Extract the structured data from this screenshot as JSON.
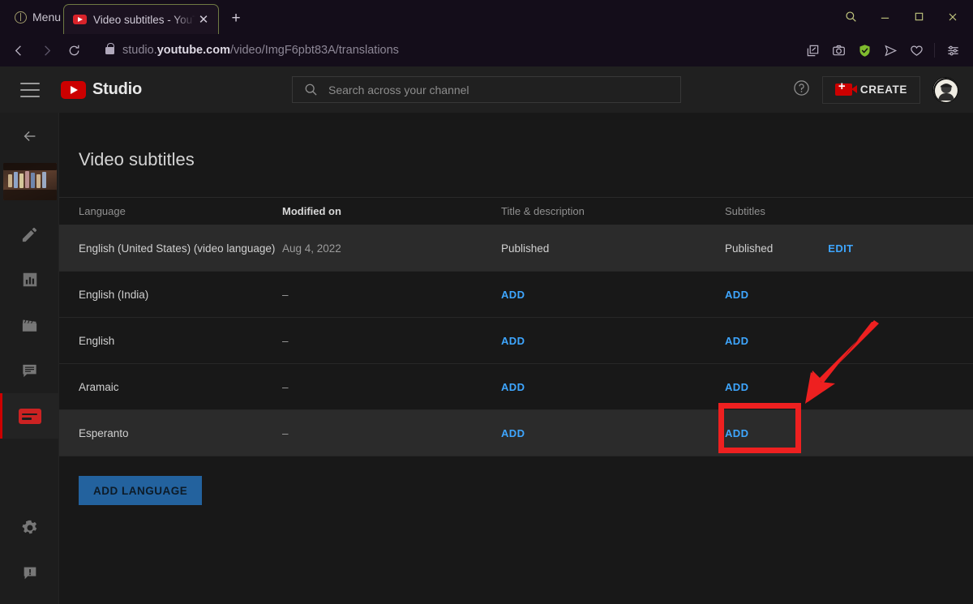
{
  "browser": {
    "menu_label": "Menu",
    "tab": {
      "title": "Video subtitles - YouTube S",
      "favicon": "youtube-favicon",
      "close": "✕"
    },
    "new_tab": "+",
    "url": {
      "domain_pre": "studio.",
      "domain_bold": "youtube.com",
      "path": "/video/ImgF6pbt83A/translations"
    },
    "window_controls": [
      "search-icon",
      "minimize-icon",
      "maximize-icon",
      "close-icon"
    ],
    "toolbar_icons": [
      "collections-icon",
      "screenshot-icon",
      "shield-verified-icon",
      "send-icon",
      "favorite-heart-icon",
      "settings-sliders-icon"
    ],
    "colors": {
      "shield_ok": "#7fbb2e",
      "window_control": "#c2c77f",
      "tab_border": "#6f7a43"
    }
  },
  "studio": {
    "brand": "Studio",
    "search": {
      "placeholder": "Search across your channel"
    },
    "create_label": "CREATE",
    "sidebar": {
      "items": [
        {
          "name": "back-arrow",
          "label": "Back"
        },
        {
          "name": "video-thumbnail",
          "label": "Video thumbnail"
        },
        {
          "name": "details-pencil",
          "label": "Details"
        },
        {
          "name": "analytics",
          "label": "Analytics"
        },
        {
          "name": "editor",
          "label": "Editor"
        },
        {
          "name": "comments",
          "label": "Comments"
        },
        {
          "name": "subtitles",
          "label": "Subtitles",
          "active": true
        },
        {
          "name": "settings",
          "label": "Settings"
        },
        {
          "name": "feedback",
          "label": "Send feedback"
        }
      ]
    }
  },
  "page": {
    "title": "Video subtitles",
    "columns": [
      "Language",
      "Modified on",
      "Title & description",
      "Subtitles"
    ],
    "rows": [
      {
        "language": "English (United States) (video language)",
        "modified": "Aug 4, 2022",
        "title_desc": "Published",
        "subtitles_status": "Published",
        "action": "EDIT",
        "shaded": true
      },
      {
        "language": "English (India)",
        "modified": "–",
        "title_desc": "ADD",
        "subtitles_status": "",
        "action": "ADD",
        "shaded": false
      },
      {
        "language": "English",
        "modified": "–",
        "title_desc": "ADD",
        "subtitles_status": "",
        "action": "ADD",
        "shaded": false
      },
      {
        "language": "Aramaic",
        "modified": "–",
        "title_desc": "ADD",
        "subtitles_status": "",
        "action": "ADD",
        "shaded": false
      },
      {
        "language": "Esperanto",
        "modified": "–",
        "title_desc": "ADD",
        "subtitles_status": "",
        "action": "ADD",
        "shaded": true
      }
    ],
    "add_language_label": "ADD LANGUAGE",
    "link_color": "#3ea6ff",
    "button_color": "#23629e"
  },
  "annotation": {
    "highlight_color": "#ee2020",
    "target": "subtitles-add-link-esperanto"
  }
}
